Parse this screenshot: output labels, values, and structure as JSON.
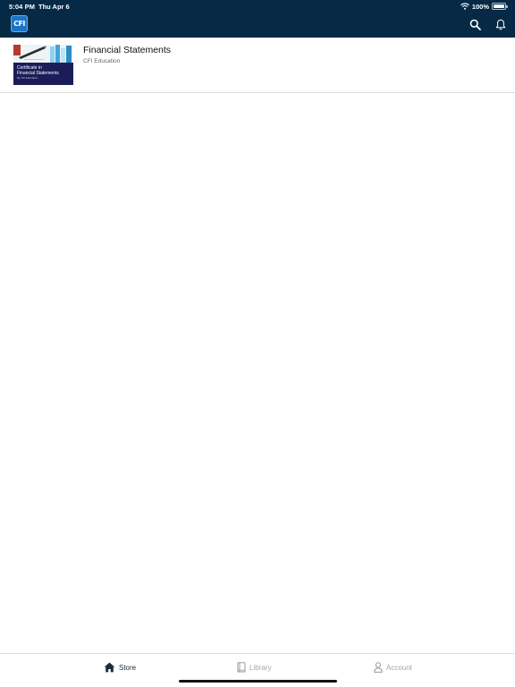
{
  "status_bar": {
    "time": "5:04 PM",
    "date": "Thu Apr 6",
    "battery": "100%"
  },
  "header": {
    "logo_text": "CFI",
    "brand_color": "#062a45",
    "icons": [
      "search-icon",
      "bell-icon"
    ]
  },
  "courses": [
    {
      "title": "Financial Statements",
      "provider": "CFI Education",
      "thumbnail": {
        "line1": "Certificate in",
        "line2": "Financial Statements",
        "line3": "By CFI Education"
      }
    }
  ],
  "tab_bar": {
    "active_color": "#1a2b3f",
    "inactive_color": "#a4a4a4",
    "tabs": [
      {
        "label": "Store",
        "icon": "home-icon",
        "active": true
      },
      {
        "label": "Library",
        "icon": "book-icon",
        "active": false
      },
      {
        "label": "Account",
        "icon": "person-icon",
        "active": false
      }
    ]
  }
}
